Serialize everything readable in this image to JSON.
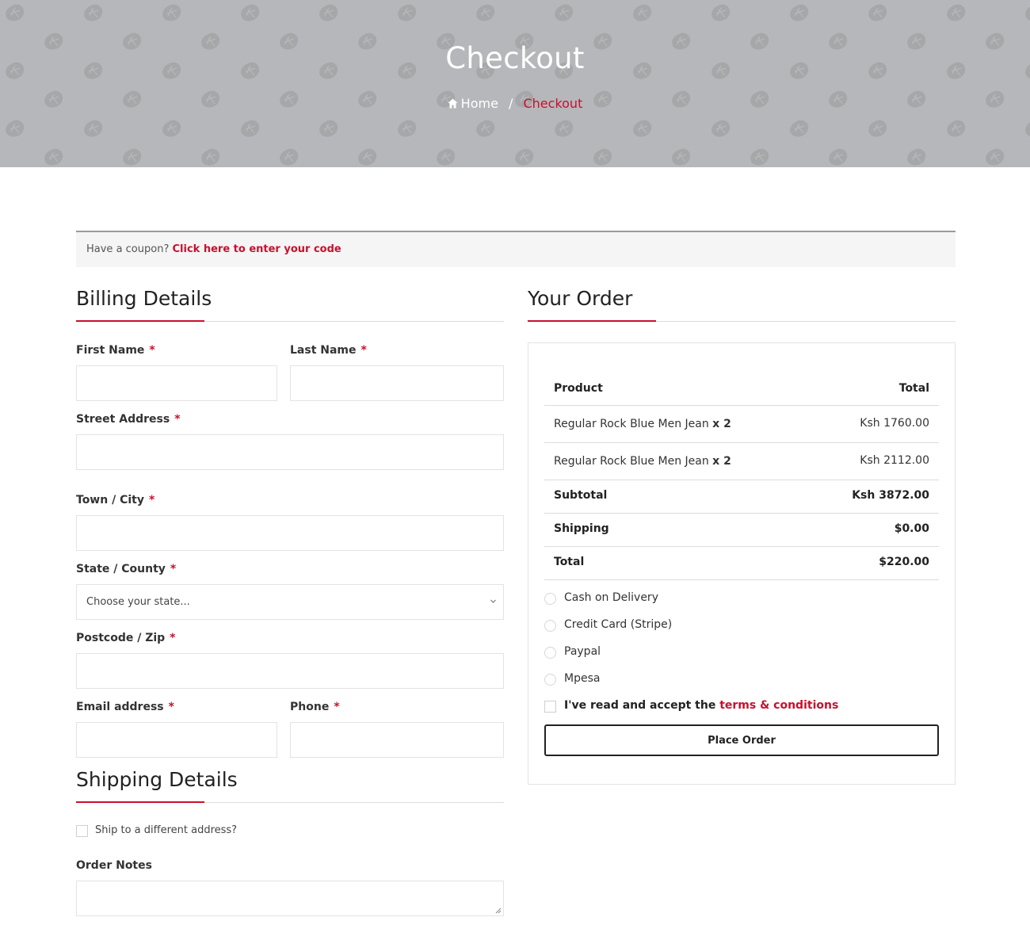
{
  "hero": {
    "title": "Checkout",
    "breadcrumb": {
      "home": "Home",
      "separator": "/",
      "current": "Checkout"
    }
  },
  "coupon": {
    "prompt": "Have a coupon?",
    "link": "Click here to enter your code"
  },
  "billing": {
    "title": "Billing Details",
    "required_mark": "*",
    "first_name_label": "First Name",
    "last_name_label": "Last Name",
    "street_label": "Street Address",
    "city_label": "Town / City",
    "state_label": "State / County",
    "state_selected": "Choose your state...",
    "postcode_label": "Postcode / Zip",
    "email_label": "Email address",
    "phone_label": "Phone"
  },
  "shipping": {
    "title": "Shipping Details",
    "ship_different_label": "Ship to a different address?",
    "order_notes_label": "Order Notes"
  },
  "order": {
    "title": "Your Order",
    "header": {
      "product": "Product",
      "total": "Total"
    },
    "items": [
      {
        "name": "Regular Rock Blue Men Jean",
        "qty": "x 2",
        "total": "Ksh 1760.00"
      },
      {
        "name": "Regular Rock Blue Men Jean",
        "qty": "x 2",
        "total": "Ksh 2112.00"
      }
    ],
    "subtotal_label": "Subtotal",
    "subtotal_value": "Ksh 3872.00",
    "shipping_label": "Shipping",
    "shipping_value": "$0.00",
    "total_label": "Total",
    "total_value": "$220.00",
    "payment_methods": [
      "Cash on Delivery",
      "Credit Card (Stripe)",
      "Paypal",
      "Mpesa"
    ],
    "terms_prefix": "I've read and accept the",
    "terms_link": "terms & conditions",
    "place_order": "Place Order"
  },
  "colors": {
    "accent": "#c8102e",
    "hero_bg": "#b6b7ba",
    "coupon_bg": "#f5f5f5"
  }
}
